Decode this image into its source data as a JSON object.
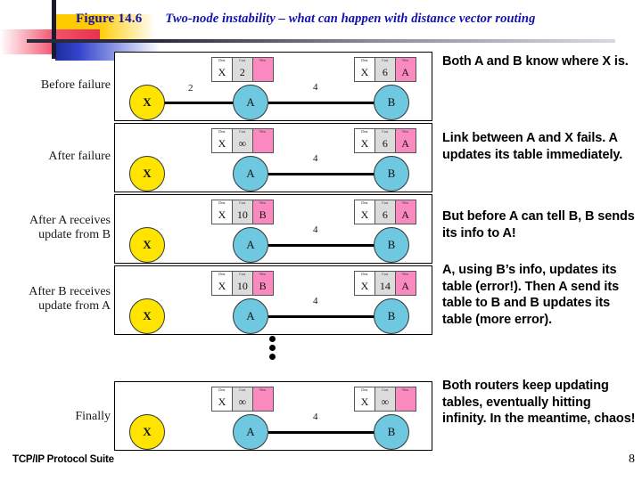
{
  "title": {
    "figure_number": "Figure 14.6",
    "caption": "Two-node instability – what can happen with distance vector routing"
  },
  "footer": {
    "left_text": "TCP/IP Protocol Suite",
    "page_number": "8"
  },
  "table_headers": {
    "dest": "Dest.",
    "cost": "Cost",
    "hop": "Next"
  },
  "stages": [
    {
      "label": "Before failure",
      "x_node": "X",
      "a_node": "A",
      "b_node": "B",
      "link_xa_cost": "2",
      "link_ab_cost": "4",
      "link_xa_up": true,
      "a_table": {
        "dest": "X",
        "cost": "2",
        "hop": ""
      },
      "b_table": {
        "dest": "X",
        "cost": "6",
        "hop": "A"
      }
    },
    {
      "label": "After failure",
      "x_node": "X",
      "a_node": "A",
      "b_node": "B",
      "link_xa_cost": "",
      "link_ab_cost": "4",
      "link_xa_up": false,
      "a_table": {
        "dest": "X",
        "cost": "∞",
        "hop": ""
      },
      "b_table": {
        "dest": "X",
        "cost": "6",
        "hop": "A"
      }
    },
    {
      "label": "After A receives\nupdate from B",
      "x_node": "X",
      "a_node": "A",
      "b_node": "B",
      "link_xa_cost": "",
      "link_ab_cost": "4",
      "link_xa_up": false,
      "a_table": {
        "dest": "X",
        "cost": "10",
        "hop": "B"
      },
      "b_table": {
        "dest": "X",
        "cost": "6",
        "hop": "A"
      }
    },
    {
      "label": "After B receives\nupdate from A",
      "x_node": "X",
      "a_node": "A",
      "b_node": "B",
      "link_xa_cost": "",
      "link_ab_cost": "4",
      "link_xa_up": false,
      "a_table": {
        "dest": "X",
        "cost": "10",
        "hop": "B"
      },
      "b_table": {
        "dest": "X",
        "cost": "14",
        "hop": "A"
      }
    },
    {
      "label": "Finally",
      "x_node": "X",
      "a_node": "A",
      "b_node": "B",
      "link_xa_cost": "",
      "link_ab_cost": "4",
      "link_xa_up": false,
      "a_table": {
        "dest": "X",
        "cost": "∞",
        "hop": ""
      },
      "b_table": {
        "dest": "X",
        "cost": "∞",
        "hop": ""
      }
    }
  ],
  "annotations": [
    "Both A and B know where X is.",
    "Link between A and X fails.  A updates its table immediately.",
    "But before A can tell B, B sends its info to A!",
    "A, using B’s info, updates its table (error!). Then A send its table to B and B updates its table (more error).",
    "Both routers keep updating tables, eventually hitting infinity. In the meantime, chaos!"
  ],
  "colors": {
    "title_blue": "#1010B0",
    "x_node_yellow": "#FFE400",
    "router_node_cyan": "#6EC8E0",
    "next_hop_pink": "#F989BE",
    "cost_gray": "#DCDCDC"
  }
}
